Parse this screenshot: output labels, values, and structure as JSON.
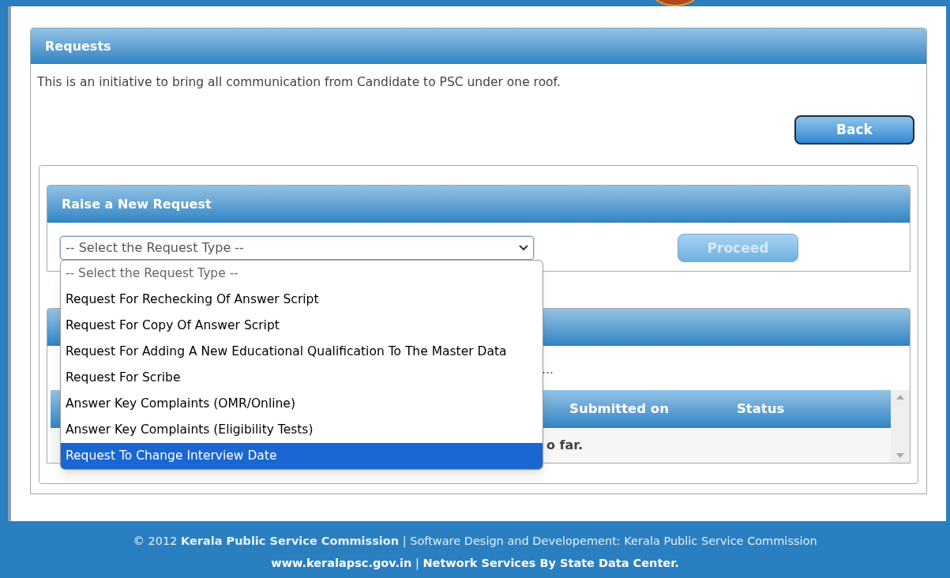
{
  "requests_panel": {
    "title": "Requests",
    "intro": "This is an initiative to bring all communication from Candidate to PSC under one roof.",
    "back_button": "Back"
  },
  "new_request_panel": {
    "title": "Raise a New Request",
    "select": {
      "value": "-- Select the Request Type --",
      "expanded": true
    },
    "proceed_button": {
      "label": "Proceed",
      "disabled": true
    }
  },
  "dropdown_options": [
    {
      "label": "-- Select the Request Type --",
      "selected": false,
      "placeholder": true
    },
    {
      "label": "Request For Rechecking Of Answer Script",
      "selected": false,
      "placeholder": false
    },
    {
      "label": "Request For Copy Of Answer Script",
      "selected": false,
      "placeholder": false
    },
    {
      "label": "Request For Adding A New Educational Qualification To The Master Data",
      "selected": false,
      "placeholder": false
    },
    {
      "label": "Request For Scribe",
      "selected": false,
      "placeholder": false
    },
    {
      "label": "Answer Key Complaints (OMR/Online)",
      "selected": false,
      "placeholder": false
    },
    {
      "label": "Answer Key Complaints (Eligibility Tests)",
      "selected": false,
      "placeholder": false
    },
    {
      "label": "Request To Change Interview Date",
      "selected": true,
      "placeholder": false
    }
  ],
  "history_panel": {
    "note": "…",
    "table": {
      "columns": [
        "Submitted on",
        "Status"
      ],
      "empty_message": "o far."
    }
  },
  "footer": {
    "line_1": "© 2012 **Kerala Public Service Commission** | Software Design and Developement: Kerala Public Service Commission",
    "line_2": "**www.keralapsc.gov.in** | **Network Services By State Data Center.**"
  }
}
